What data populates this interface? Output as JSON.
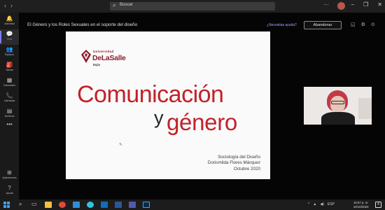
{
  "titlebar": {
    "search_placeholder": "Buscar",
    "nav_icons": [
      "back-icon",
      "forward-icon"
    ],
    "window_controls": [
      "more-icon",
      "minimize-icon",
      "maximize-icon",
      "close-icon"
    ]
  },
  "rail": {
    "items": [
      {
        "label": "Actividad",
        "icon": "bell-icon",
        "glyph": "🔔"
      },
      {
        "label": "Chat",
        "icon": "chat-icon",
        "glyph": "💬",
        "active": true
      },
      {
        "label": "Equipos",
        "icon": "teams-icon",
        "glyph": "👥"
      },
      {
        "label": "Tareas",
        "icon": "assignments-icon",
        "glyph": "🎒"
      },
      {
        "label": "Calendario",
        "icon": "calendar-icon",
        "glyph": "▦"
      },
      {
        "label": "Llamadas",
        "icon": "phone-icon",
        "glyph": "📞"
      },
      {
        "label": "Archivos",
        "icon": "files-icon",
        "glyph": "▤"
      },
      {
        "label": "",
        "icon": "more-dots-icon",
        "glyph": "•••"
      }
    ],
    "bottom_items": [
      {
        "label": "Aplicaciones",
        "icon": "apps-icon",
        "glyph": "⊞"
      },
      {
        "label": "Ayuda",
        "icon": "help-icon",
        "glyph": "?"
      }
    ]
  },
  "meeting": {
    "title": "El Género y los Roles Sexuales en el soporte del diseño",
    "help_link": "¿Necesitas ayuda?",
    "leave_button": "Abandonar"
  },
  "slide": {
    "logo_top": "Universidad",
    "logo_name": "DeLaSalle",
    "logo_campus": "Bajío",
    "title_line1": "Comunicación",
    "title_y": "y",
    "title_line2": "género",
    "info_line1": "Sociología del Diseño",
    "info_line2": "Dorismilda Flores Márquez",
    "info_line3": "Octubre 2020"
  },
  "taskbar": {
    "time": "15:57 p. m.",
    "date": "20/10/2020",
    "tray_lang": "ESP",
    "notif_count": "4",
    "apps": [
      "windows-icon",
      "search-icon",
      "task-view-icon",
      "explorer-icon",
      "chrome-icon",
      "edge-icon",
      "store-icon",
      "outlook-icon",
      "word-icon",
      "teams-icon",
      "photoshop-icon"
    ]
  },
  "colors": {
    "accent": "#7b7ff0",
    "slide_red": "#c32128",
    "logo_red": "#8a1f2b"
  }
}
